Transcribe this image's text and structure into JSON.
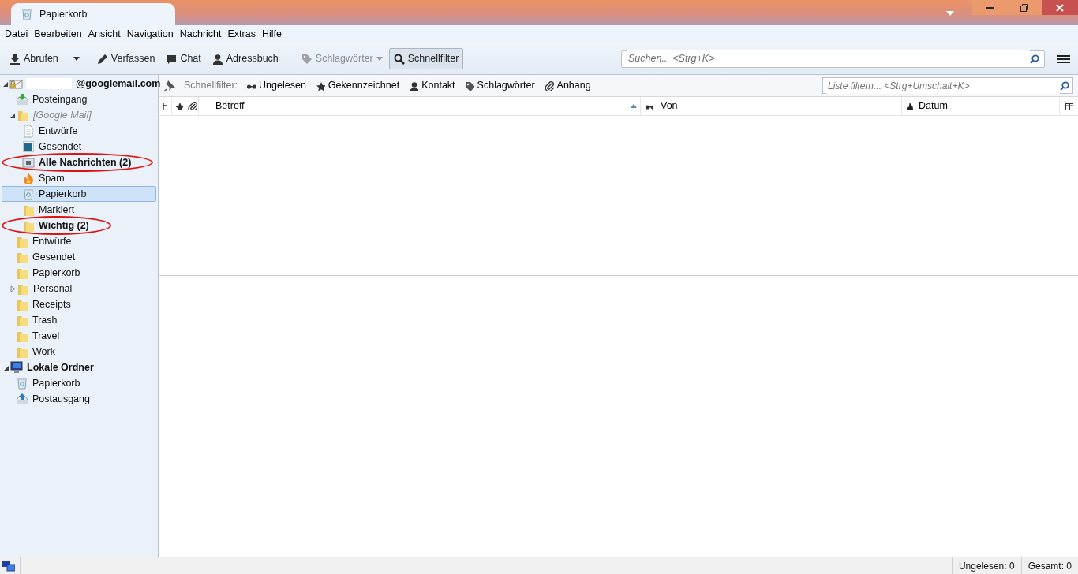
{
  "window": {
    "title": "Papierkorb"
  },
  "menu": [
    {
      "label": "Datei"
    },
    {
      "label": "Bearbeiten"
    },
    {
      "label": "Ansicht"
    },
    {
      "label": "Navigation"
    },
    {
      "label": "Nachricht"
    },
    {
      "label": "Extras"
    },
    {
      "label": "Hilfe"
    }
  ],
  "toolbar": [
    {
      "kind": "download",
      "label": "Abrufen",
      "disabled": false,
      "pressed": false
    },
    {
      "kind": "dropdown"
    },
    {
      "kind": "pencil",
      "label": "Verfassen",
      "disabled": false,
      "pressed": false
    },
    {
      "kind": "chat",
      "label": "Chat",
      "disabled": false,
      "pressed": false
    },
    {
      "kind": "person",
      "label": "Adressbuch",
      "disabled": false,
      "pressed": false
    },
    {
      "kind": "separator"
    },
    {
      "kind": "tag",
      "label": "Schlagwörter",
      "menu": true,
      "disabled": true,
      "pressed": false
    },
    {
      "kind": "search",
      "label": "Schnellfilter",
      "disabled": false,
      "pressed": true
    }
  ],
  "search": {
    "placeholder": "Suchen... <Strg+K>"
  },
  "folders": [
    {
      "kind": "account",
      "label": "@googlemail.com",
      "redacted": true,
      "bold": true,
      "italic": false,
      "selected": false,
      "circled": false,
      "expanded": true,
      "children": [
        {
          "kind": "inbox",
          "label": "Posteingang",
          "bold": false,
          "italic": false,
          "selected": false,
          "circled": false
        },
        {
          "kind": "folder",
          "label": "[Google Mail]",
          "bold": false,
          "italic": true,
          "selected": false,
          "circled": false,
          "expanded": true,
          "children": [
            {
              "kind": "drafts",
              "label": "Entwürfe",
              "bold": false,
              "italic": false,
              "selected": false,
              "circled": false
            },
            {
              "kind": "sent",
              "label": "Gesendet",
              "bold": false,
              "italic": false,
              "selected": false,
              "circled": false
            },
            {
              "kind": "archive",
              "label": "Alle Nachrichten (2)",
              "bold": true,
              "italic": false,
              "selected": false,
              "circled": true
            },
            {
              "kind": "spam",
              "label": "Spam",
              "bold": false,
              "italic": false,
              "selected": false,
              "circled": false
            },
            {
              "kind": "trash",
              "label": "Papierkorb",
              "bold": false,
              "italic": false,
              "selected": true,
              "circled": false
            },
            {
              "kind": "folder",
              "label": "Markiert",
              "bold": false,
              "italic": false,
              "selected": false,
              "circled": false
            },
            {
              "kind": "folder",
              "label": "Wichtig (2)",
              "bold": true,
              "italic": false,
              "selected": false,
              "circled": true
            }
          ]
        },
        {
          "kind": "folder",
          "label": "Entwürfe",
          "bold": false,
          "italic": false,
          "selected": false,
          "circled": false
        },
        {
          "kind": "folder",
          "label": "Gesendet",
          "bold": false,
          "italic": false,
          "selected": false,
          "circled": false
        },
        {
          "kind": "folder",
          "label": "Papierkorb",
          "bold": false,
          "italic": false,
          "selected": false,
          "circled": false
        },
        {
          "kind": "folder",
          "label": "Personal",
          "bold": false,
          "italic": false,
          "selected": false,
          "circled": false,
          "expanded": false
        },
        {
          "kind": "folder",
          "label": "Receipts",
          "bold": false,
          "italic": false,
          "selected": false,
          "circled": false
        },
        {
          "kind": "folder",
          "label": "Trash",
          "bold": false,
          "italic": false,
          "selected": false,
          "circled": false
        },
        {
          "kind": "folder",
          "label": "Travel",
          "bold": false,
          "italic": false,
          "selected": false,
          "circled": false
        },
        {
          "kind": "folder",
          "label": "Work",
          "bold": false,
          "italic": false,
          "selected": false,
          "circled": false
        }
      ]
    },
    {
      "kind": "local",
      "label": "Lokale Ordner",
      "bold": true,
      "italic": false,
      "selected": false,
      "circled": false,
      "expanded": true,
      "children": [
        {
          "kind": "trash",
          "label": "Papierkorb",
          "bold": false,
          "italic": false,
          "selected": false,
          "circled": false
        },
        {
          "kind": "outbox",
          "label": "Postausgang",
          "bold": false,
          "italic": false,
          "selected": false,
          "circled": false
        }
      ]
    }
  ],
  "quick_filter": {
    "label": "Schnellfilter:",
    "buttons": [
      {
        "kind": "glasses",
        "label": "Ungelesen"
      },
      {
        "kind": "star",
        "label": "Gekennzeichnet"
      },
      {
        "kind": "person",
        "label": "Kontakt"
      },
      {
        "kind": "tag",
        "label": "Schlagwörter"
      },
      {
        "kind": "clip",
        "label": "Anhang"
      }
    ],
    "placeholder": "Liste filtern... <Strg+Umschalt+K>"
  },
  "columns": [
    {
      "kind": "thread",
      "sorted": false
    },
    {
      "kind": "star",
      "sorted": false
    },
    {
      "kind": "clip",
      "sorted": false
    },
    {
      "kind": "text",
      "label": "Betreff",
      "sorted": true
    },
    {
      "kind": "glasses",
      "sorted": false
    },
    {
      "kind": "text",
      "label": "Von",
      "sorted": false
    },
    {
      "kind": "flame",
      "sorted": false
    },
    {
      "kind": "text",
      "label": "Datum",
      "sorted": false
    },
    {
      "kind": "picker",
      "sorted": false
    }
  ],
  "status_bar": [
    "Ungelesen: 0",
    "Gesamt: 0"
  ]
}
